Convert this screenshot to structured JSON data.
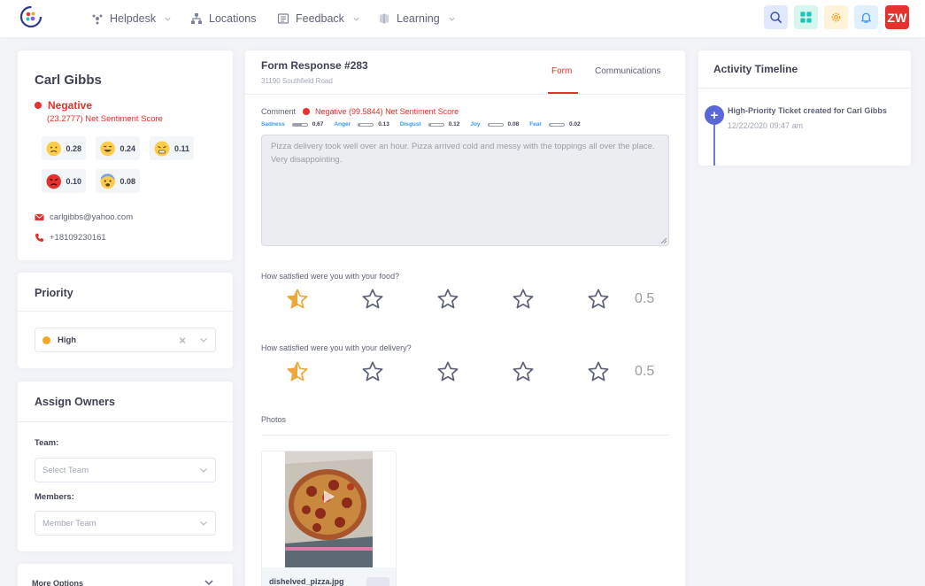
{
  "nav": {
    "helpdesk": "Helpdesk",
    "locations": "Locations",
    "feedback": "Feedback",
    "learning": "Learning",
    "avatar_initials": "ZW"
  },
  "customer": {
    "name": "Carl Gibbs",
    "sentiment_label": "Negative",
    "sentiment_score": "(23.2777) Net Sentiment Score",
    "emotions": [
      {
        "icon": "sad-face-icon",
        "value": "0.28"
      },
      {
        "icon": "joy-face-icon",
        "value": "0.24"
      },
      {
        "icon": "disgust-face-icon",
        "value": "0.11"
      },
      {
        "icon": "angry-face-icon",
        "value": "0.10"
      },
      {
        "icon": "fear-face-icon",
        "value": "0.08"
      }
    ],
    "email": "carlgibbs@yahoo.com",
    "phone": "+18109230161"
  },
  "priority": {
    "title": "Priority",
    "value": "High",
    "clear": "×"
  },
  "assign": {
    "title": "Assign Owners",
    "team_label": "Team:",
    "team_placeholder": "Select Team",
    "members_label": "Members:",
    "members_placeholder": "Member Team"
  },
  "more_options": "More Options",
  "form": {
    "title": "Form Response #283",
    "address": "31190 Southfield Road",
    "tab_form": "Form",
    "tab_communications": "Communications",
    "comment_label": "Comment",
    "comment_sentiment": "Negative (99.5844) Net Sentiment Score",
    "emotions": [
      {
        "name": "Sadness",
        "value": "0.67",
        "fill": 0.67
      },
      {
        "name": "Anger",
        "value": "0.13",
        "fill": 0.13
      },
      {
        "name": "Disgust",
        "value": "0.12",
        "fill": 0.12
      },
      {
        "name": "Joy",
        "value": "0.08",
        "fill": 0.08
      },
      {
        "name": "Fear",
        "value": "0.02",
        "fill": 0.02
      }
    ],
    "comment_text": "Pizza delivery took well over an hour. Pizza arrived cold and messy with the toppings all over the place. Very disappointing.",
    "q_food": "How satisfied were you with your food?",
    "food_rating": "0.5",
    "food_rating_value": 0.5,
    "q_delivery": "How satisfied were you with your delivery?",
    "delivery_rating": "0.5",
    "delivery_rating_value": 0.5,
    "photos_label": "Photos",
    "photo_name": "dishelved_pizza.jpg"
  },
  "activity": {
    "title": "Activity Timeline",
    "items": [
      {
        "text": "High-Priority Ticket created for Carl Gibbs",
        "time": "12/22/2020 09:47 am"
      }
    ]
  },
  "colors": {
    "accent_red": "#e5322d",
    "primary_blue": "#3699ff",
    "star_gold": "#f0a73a",
    "timeline": "#5a67d8"
  }
}
